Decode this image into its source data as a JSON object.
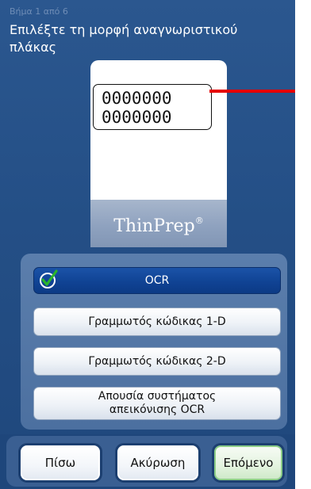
{
  "header": {
    "step": "Βήμα 1 από 6",
    "instruction": "Επιλέξτε τη μορφή αναγνωριστικού πλάκας"
  },
  "slide_illustration": {
    "label_line_1": "0000000",
    "label_line_2": "0000000",
    "brand": "ThinPrep",
    "brand_mark": "®",
    "pointer_color": "#e60000"
  },
  "options": {
    "ocr": {
      "label": "OCR",
      "selected": true
    },
    "barcode_1d": {
      "label": "Γραμμωτός κώδικας 1-D",
      "selected": false
    },
    "barcode_2d": {
      "label": "Γραμμωτός κώδικας 2-D",
      "selected": false
    },
    "no_ocr": {
      "label_line_1": "Απουσία συστήματος",
      "label_line_2": "απεικόνισης OCR",
      "selected": false
    },
    "check_icon": "checkmark-icon",
    "check_color": "#2bb52b"
  },
  "footer": {
    "back_label": "Πίσω",
    "cancel_label": "Ακύρωση",
    "next_label": "Επόμενο"
  },
  "colors": {
    "background": "#244f86",
    "selected_option": "#104394",
    "next_button_border": "#8ccd87"
  }
}
